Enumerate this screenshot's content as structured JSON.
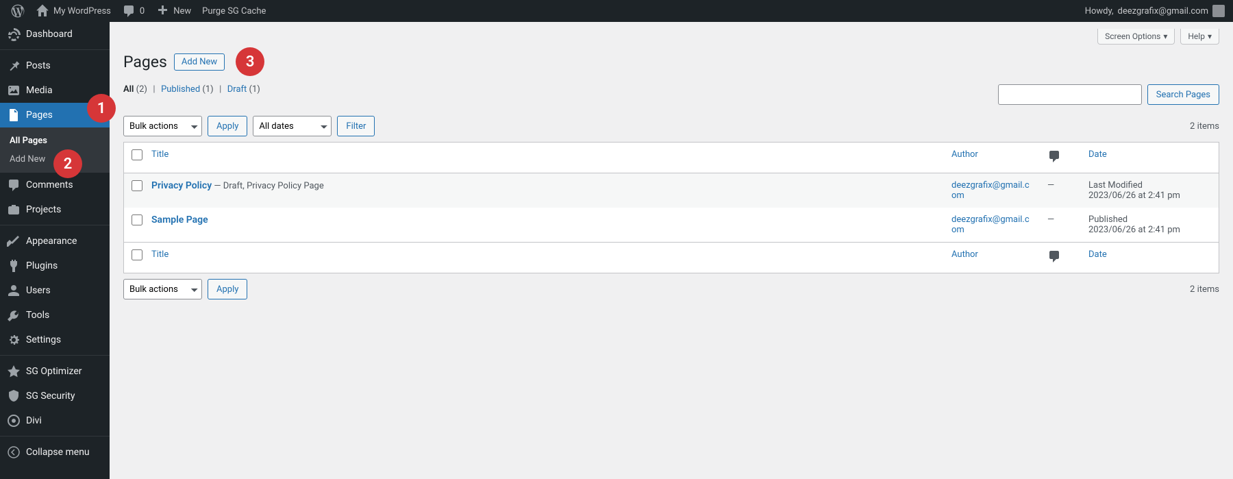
{
  "adminbar": {
    "site_name": "My WordPress",
    "comments_count": "0",
    "new_label": "New",
    "purge_label": "Purge SG Cache",
    "howdy_prefix": "Howdy, ",
    "user": "deezgrafix@gmail.com"
  },
  "annotations": {
    "b1": "1",
    "b2": "2",
    "b3": "3"
  },
  "sidebar": {
    "dashboard": "Dashboard",
    "posts": "Posts",
    "media": "Media",
    "pages": "Pages",
    "pages_sub_all": "All Pages",
    "pages_sub_add": "Add New",
    "comments": "Comments",
    "projects": "Projects",
    "appearance": "Appearance",
    "plugins": "Plugins",
    "users": "Users",
    "tools": "Tools",
    "settings": "Settings",
    "sg_optimizer": "SG Optimizer",
    "sg_security": "SG Security",
    "divi": "Divi",
    "collapse": "Collapse menu"
  },
  "topcontrols": {
    "screen_options": "Screen Options",
    "help": "Help"
  },
  "header": {
    "title": "Pages",
    "add_new": "Add New"
  },
  "filters": {
    "all_label": "All ",
    "all_count": "(2)",
    "published_label": "Published ",
    "published_count": "(1)",
    "draft_label": "Draft ",
    "draft_count": "(1)"
  },
  "search": {
    "placeholder": "",
    "button": "Search Pages"
  },
  "tablenav": {
    "bulk_selected": "Bulk actions",
    "apply": "Apply",
    "dates_selected": "All dates",
    "filter": "Filter",
    "items_count": "2 items"
  },
  "table": {
    "col_title": "Title",
    "col_author": "Author",
    "col_date": "Date",
    "rows": [
      {
        "title": "Privacy Policy",
        "title_suffix": " — Draft, Privacy Policy Page",
        "author": "deezgrafix@gmail.com",
        "comments": "—",
        "date_line1": "Last Modified",
        "date_line2": "2023/06/26 at 2:41 pm"
      },
      {
        "title": "Sample Page",
        "title_suffix": "",
        "author": "deezgrafix@gmail.com",
        "comments": "—",
        "date_line1": "Published",
        "date_line2": "2023/06/26 at 2:41 pm"
      }
    ]
  }
}
